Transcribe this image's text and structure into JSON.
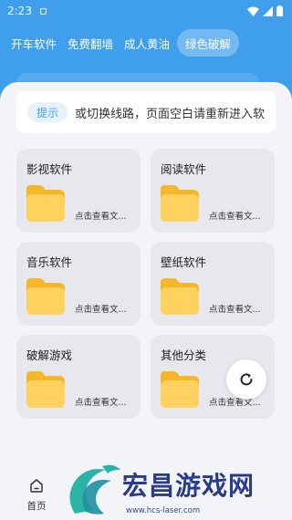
{
  "status_bar": {
    "time": "2:23"
  },
  "tabs": [
    {
      "label": "开车软件",
      "active": false
    },
    {
      "label": "免费翻墙",
      "active": false
    },
    {
      "label": "成人黄油",
      "active": false
    },
    {
      "label": "绿色破解",
      "active": true
    }
  ],
  "notice": {
    "badge": "提示",
    "text": "或切换线路，页面空白请重新进入软"
  },
  "cards": [
    {
      "title": "影视软件",
      "link": "点击查看文..."
    },
    {
      "title": "阅读软件",
      "link": "点击查看文..."
    },
    {
      "title": "音乐软件",
      "link": "点击查看文..."
    },
    {
      "title": "壁纸软件",
      "link": "点击查看文..."
    },
    {
      "title": "破解游戏",
      "link": "点击查看文..."
    },
    {
      "title": "其他分类",
      "link": "点击查看文..."
    }
  ],
  "bottom_nav": {
    "home_label": "首页"
  },
  "watermark": {
    "text": "宏昌游戏网",
    "url": "www.hcs-laser.com"
  },
  "colors": {
    "primary": "#3f9fec",
    "folder": "#ffd260",
    "card": "#e7e8ed"
  }
}
